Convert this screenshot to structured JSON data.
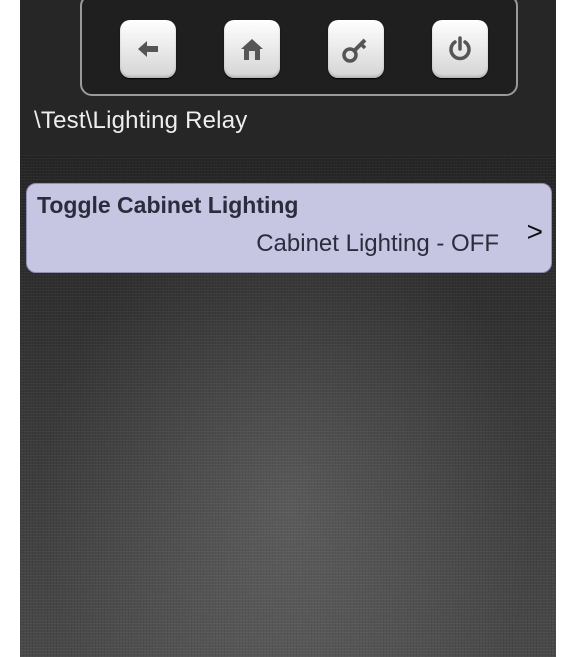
{
  "toolbar": {
    "buttons": [
      {
        "icon": "back-arrow-icon"
      },
      {
        "icon": "home-icon"
      },
      {
        "icon": "key-icon"
      },
      {
        "icon": "power-icon"
      }
    ]
  },
  "breadcrumb": "\\Test\\Lighting Relay",
  "menu": {
    "items": [
      {
        "title": "Toggle Cabinet Lighting",
        "status": "Cabinet Lighting - OFF",
        "chevron": ">"
      }
    ]
  },
  "colors": {
    "item_background": "#c6c6e2",
    "screen_background": "#2c2c2c"
  }
}
